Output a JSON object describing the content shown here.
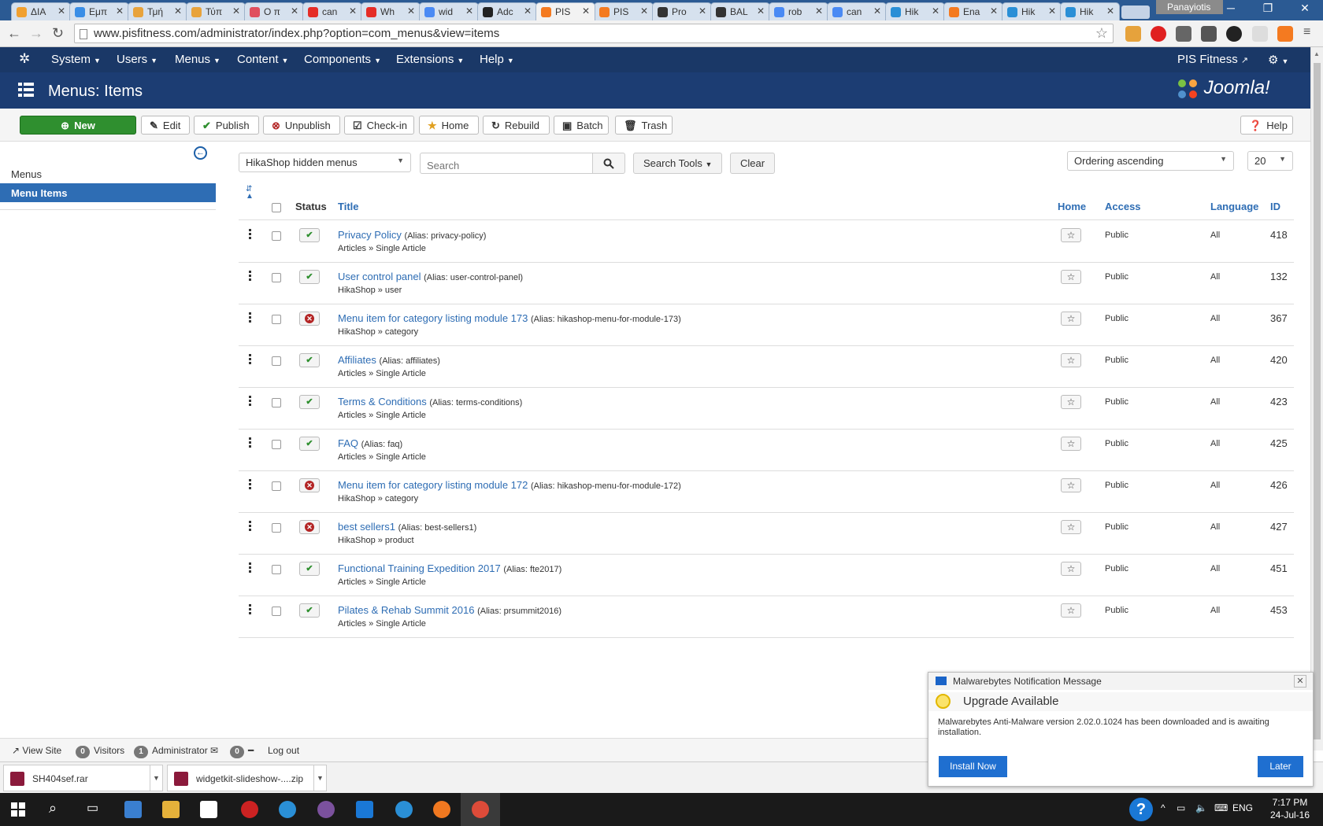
{
  "browser": {
    "tabs": [
      {
        "label": "ΔΙΑ",
        "color": "#f0a030"
      },
      {
        "label": "Εμπ",
        "color": "#3a8ee6"
      },
      {
        "label": "Τμή",
        "color": "#e8a33c"
      },
      {
        "label": "Τύπ",
        "color": "#e8a33c"
      },
      {
        "label": "Ο π",
        "color": "#e04f5f"
      },
      {
        "label": "can",
        "color": "#e52d27"
      },
      {
        "label": "Wh",
        "color": "#e52d27"
      },
      {
        "label": "wid",
        "color": "#4a8af4"
      },
      {
        "label": "Adc",
        "color": "#222222"
      },
      {
        "label": "PIS",
        "color": "#f47a20"
      },
      {
        "label": "PIS",
        "color": "#f47a20"
      },
      {
        "label": "Pro",
        "color": "#333333"
      },
      {
        "label": "BAL",
        "color": "#333333"
      },
      {
        "label": "rob",
        "color": "#4a8af4"
      },
      {
        "label": "can",
        "color": "#4a8af4"
      },
      {
        "label": "Hik",
        "color": "#2a8fd6"
      },
      {
        "label": "Ena",
        "color": "#f47a20"
      },
      {
        "label": "Hik",
        "color": "#2a8fd6"
      },
      {
        "label": "Hik",
        "color": "#2a8fd6"
      }
    ],
    "user": "Panayiotis",
    "url": "www.pisfitness.com/administrator/index.php?option=com_menus&view=items"
  },
  "joomla": {
    "nav": [
      "System",
      "Users",
      "Menus",
      "Content",
      "Components",
      "Extensions",
      "Help"
    ],
    "site_name": "PIS Fitness",
    "page_title": "Menus: Items",
    "logo_text": "Joomla!"
  },
  "toolbar": {
    "new": "New",
    "edit": "Edit",
    "publish": "Publish",
    "unpublish": "Unpublish",
    "checkin": "Check-in",
    "home": "Home",
    "rebuild": "Rebuild",
    "batch": "Batch",
    "trash": "Trash",
    "help": "Help"
  },
  "sidebar": {
    "items": [
      "Menus",
      "Menu Items"
    ]
  },
  "filters": {
    "menu_select": "HikaShop hidden menus",
    "search_placeholder": "Search",
    "search_tools": "Search Tools",
    "clear": "Clear",
    "ordering": "Ordering ascending",
    "limit": "20"
  },
  "table": {
    "headers": {
      "status": "Status",
      "title": "Title",
      "home": "Home",
      "access": "Access",
      "language": "Language",
      "id": "ID"
    },
    "rows": [
      {
        "title": "Privacy Policy",
        "alias": "(Alias: privacy-policy)",
        "type": "Articles » Single Article",
        "published": true,
        "access": "Public",
        "language": "All",
        "id": "418"
      },
      {
        "title": "User control panel",
        "alias": "(Alias: user-control-panel)",
        "type": "HikaShop » user",
        "published": true,
        "access": "Public",
        "language": "All",
        "id": "132"
      },
      {
        "title": "Menu item for category listing module 173",
        "alias": "(Alias: hikashop-menu-for-module-173)",
        "type": "HikaShop » category",
        "published": false,
        "access": "Public",
        "language": "All",
        "id": "367"
      },
      {
        "title": "Affiliates",
        "alias": "(Alias: affiliates)",
        "type": "Articles » Single Article",
        "published": true,
        "access": "Public",
        "language": "All",
        "id": "420"
      },
      {
        "title": "Terms & Conditions",
        "alias": "(Alias: terms-conditions)",
        "type": "Articles » Single Article",
        "published": true,
        "access": "Public",
        "language": "All",
        "id": "423"
      },
      {
        "title": "FAQ",
        "alias": "(Alias: faq)",
        "type": "Articles » Single Article",
        "published": true,
        "access": "Public",
        "language": "All",
        "id": "425"
      },
      {
        "title": "Menu item for category listing module 172",
        "alias": "(Alias: hikashop-menu-for-module-172)",
        "type": "HikaShop » category",
        "published": false,
        "access": "Public",
        "language": "All",
        "id": "426"
      },
      {
        "title": "best sellers1",
        "alias": "(Alias: best-sellers1)",
        "type": "HikaShop » product",
        "published": false,
        "access": "Public",
        "language": "All",
        "id": "427"
      },
      {
        "title": "Functional Training Expedition 2017",
        "alias": "(Alias: fte2017)",
        "type": "Articles » Single Article",
        "published": true,
        "access": "Public",
        "language": "All",
        "id": "451"
      },
      {
        "title": "Pilates & Rehab Summit 2016",
        "alias": "(Alias: prsummit2016)",
        "type": "Articles » Single Article",
        "published": true,
        "access": "Public",
        "language": "All",
        "id": "453"
      }
    ]
  },
  "statusbar": {
    "view_site": "View Site",
    "visitors_count": "0",
    "visitors": "Visitors",
    "admin_count": "1",
    "administrator": "Administrator",
    "messages_count": "0",
    "logout": "Log out"
  },
  "downloads": [
    "SH404sef.rar",
    "widgetkit-slideshow-....zip"
  ],
  "notification": {
    "header": "Malwarebytes Notification Message",
    "heading": "Upgrade Available",
    "message": "Malwarebytes Anti-Malware version 2.02.0.1024 has been downloaded and is awaiting installation.",
    "install": "Install Now",
    "later": "Later"
  },
  "taskbar": {
    "lang": "ENG",
    "time": "7:17 PM",
    "date": "24-Jul-16"
  }
}
